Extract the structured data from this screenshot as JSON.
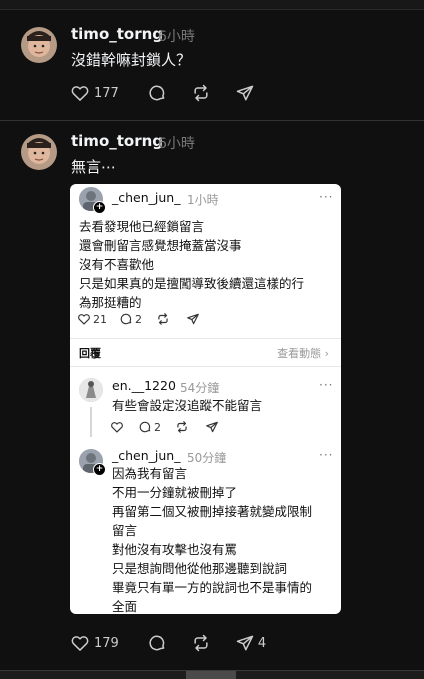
{
  "post1": {
    "username": "timo_torng",
    "time": "6小時",
    "text": "沒錯幹嘛封鎖人？",
    "likes": "177"
  },
  "post2": {
    "username": "timo_torng",
    "time": "6小時",
    "text": "無言⋯",
    "likes": "179",
    "shares": "4",
    "quoted": {
      "username": "_chen_jun_",
      "time": "1小時",
      "lines": [
        "去看發現他已經鎖留言",
        "還會刪留言感覺想掩蓋當沒事",
        "沒有不喜歡他",
        "只是如果真的是擅闖導致後續還這樣的行",
        "為那挺糟的"
      ],
      "likes": "21",
      "comments": "2",
      "replies_label": "回覆",
      "view_activity": "查看動態 ›",
      "replies": [
        {
          "username": "en.__1220",
          "time": "54分鐘",
          "lines": [
            "有些會設定沒追蹤不能留言"
          ],
          "comments": "2"
        },
        {
          "username": "_chen_jun_",
          "time": "50分鐘",
          "lines": [
            "因為我有留言",
            "不用一分鐘就被刪掉了",
            "再留第二個又被刪掉接著就變成限制",
            "留言",
            "對他沒有攻擊也沒有罵",
            "只是想詢問他從他那邊聽到說詞",
            "畢竟只有單一方的說詞也不是事情的",
            "全面"
          ]
        }
      ]
    }
  },
  "more_label": "···"
}
